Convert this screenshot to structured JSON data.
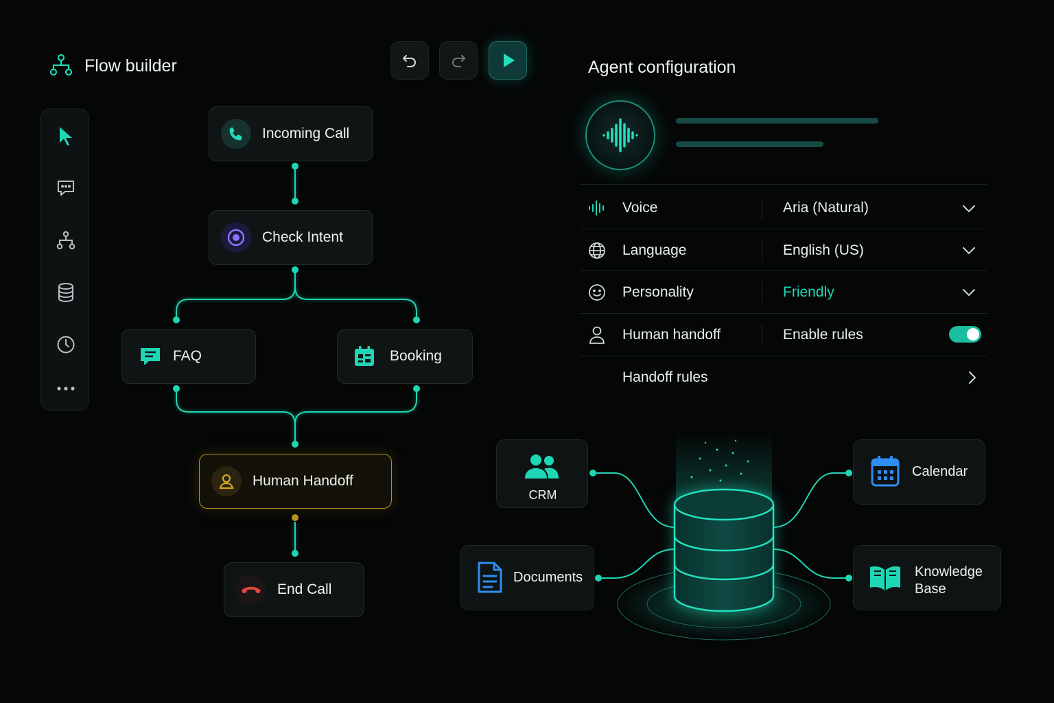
{
  "header": {
    "title": "Flow builder",
    "icon": "flow-icon"
  },
  "toolbar": {
    "undo_icon": "undo-icon",
    "redo_icon": "redo-icon",
    "play_icon": "play-icon"
  },
  "rail": {
    "items": [
      {
        "icon": "cursor-icon",
        "active": true
      },
      {
        "icon": "chat-icon"
      },
      {
        "icon": "hierarchy-icon"
      },
      {
        "icon": "database-icon"
      },
      {
        "icon": "clock-icon"
      },
      {
        "icon": "more-icon"
      }
    ]
  },
  "flow": {
    "nodes": {
      "incoming_call": "Incoming Call",
      "check_intent": "Check Intent",
      "faq": "FAQ",
      "booking": "Booking",
      "human_handoff": "Human Handoff",
      "end_call": "End Call"
    }
  },
  "agent": {
    "title": "Agent configuration",
    "rows": {
      "voice": {
        "label": "Voice",
        "value": "Aria (Natural)"
      },
      "language": {
        "label": "Language",
        "value": "English (US)"
      },
      "personality": {
        "label": "Personality",
        "value": "Friendly"
      },
      "handoff": {
        "label": "Human handoff",
        "value": "Enable rules",
        "enabled": true
      },
      "rules": {
        "label": "Handoff rules"
      }
    }
  },
  "integrations": {
    "crm": "CRM",
    "calendar": "Calendar",
    "documents": "Documents",
    "knowledge": "Knowledge Base"
  },
  "colors": {
    "accent": "#20d7b6",
    "handoff": "#d4a628",
    "end_call": "#e5493e",
    "intent": "#8b73ff",
    "blue": "#2f8ef0"
  }
}
